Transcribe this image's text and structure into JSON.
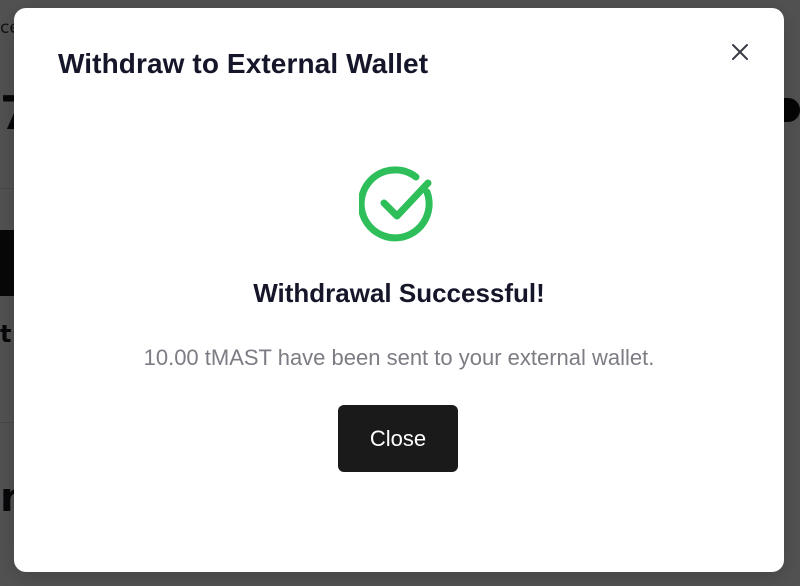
{
  "background": {
    "fragments": [
      "ce",
      "7",
      "te",
      "t",
      "n"
    ]
  },
  "modal": {
    "title": "Withdraw to External Wallet",
    "close_icon": "close-icon",
    "success_icon": "check-circle-icon",
    "success_title": "Withdrawal Successful!",
    "success_message": "10.00 tMAST have been sent to your external wallet.",
    "close_button_label": "Close"
  },
  "colors": {
    "success": "#2fbf5a",
    "button": "#1a1a1a",
    "title": "#16162a",
    "message": "#7c7c84"
  }
}
